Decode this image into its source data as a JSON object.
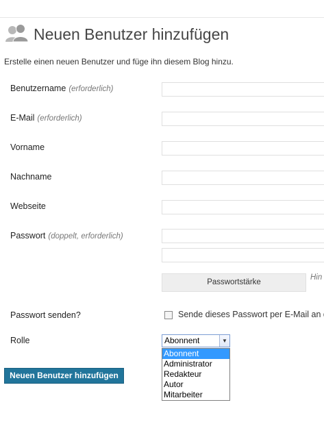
{
  "header": {
    "title": "Neuen Benutzer hinzufügen",
    "intro": "Erstelle einen neuen Benutzer und füge ihn diesem Blog hinzu."
  },
  "form": {
    "username": {
      "label": "Benutzername",
      "note": "(erforderlich)"
    },
    "email": {
      "label": "E-Mail",
      "note": "(erforderlich)"
    },
    "firstname": {
      "label": "Vorname"
    },
    "lastname": {
      "label": "Nachname"
    },
    "website": {
      "label": "Webseite"
    },
    "password": {
      "label": "Passwort",
      "note": "(doppelt, erforderlich)"
    },
    "strength": {
      "label": "Passwortstärke",
      "hint": "Hin"
    },
    "send_password": {
      "label": "Passwort senden?",
      "checkbox_label": "Sende dieses Passwort per E-Mail an d"
    },
    "role": {
      "label": "Rolle",
      "selected": "Abonnent",
      "options": [
        "Abonnent",
        "Administrator",
        "Redakteur",
        "Autor",
        "Mitarbeiter"
      ]
    },
    "submit_label": "Neuen Benutzer hinzufügen"
  },
  "icons": {
    "title_icon": "users-icon",
    "dropdown_arrow": "triangle-down-icon"
  },
  "colors": {
    "primary_button": "#21759b",
    "selected_option": "#3399ff",
    "select_border": "#7a9cd3"
  }
}
